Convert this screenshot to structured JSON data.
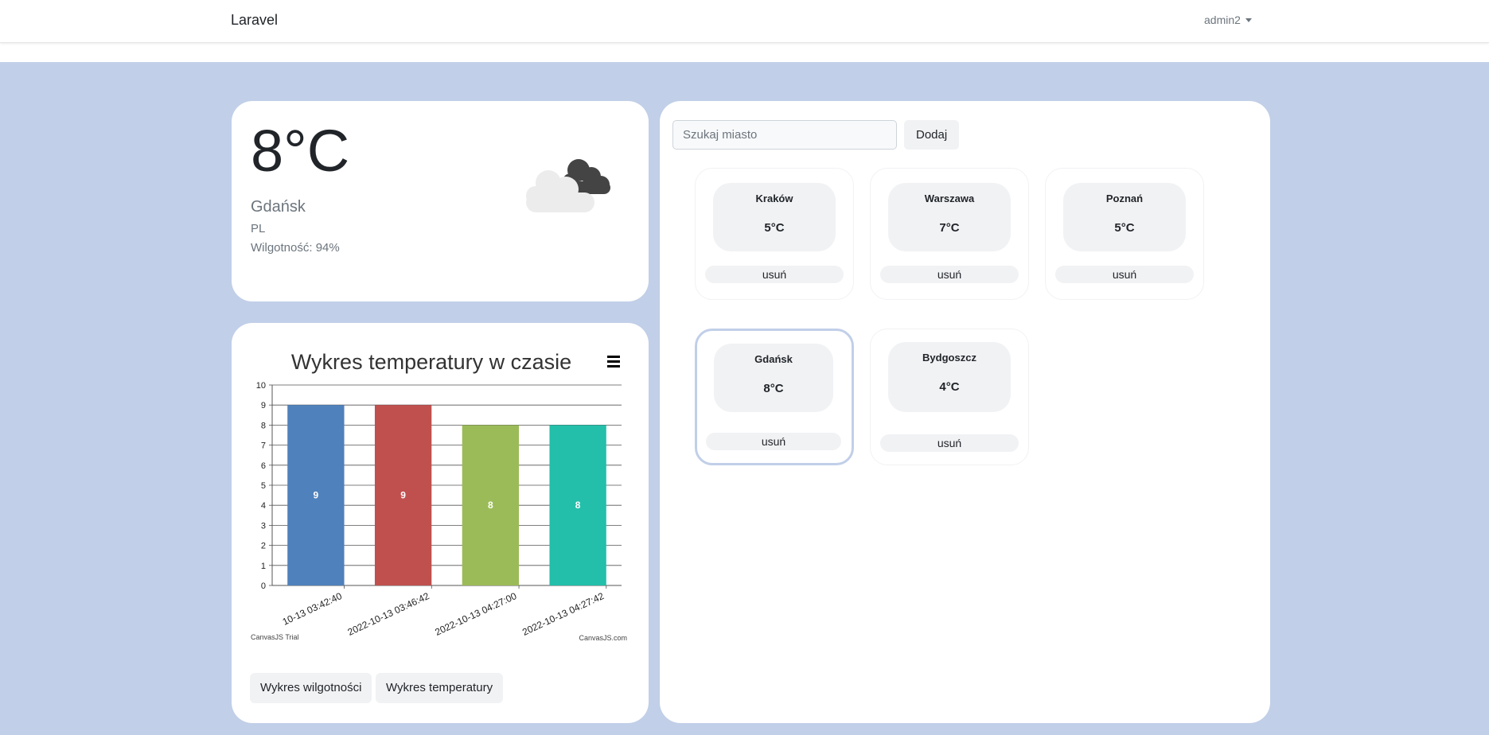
{
  "navbar": {
    "brand": "Laravel",
    "user": "admin2"
  },
  "current": {
    "temperature": "8°C",
    "city": "Gdańsk",
    "country": "PL",
    "humidity_label": "Wilgotność:",
    "humidity_value": "94%",
    "condition_icon": "cloud-icon"
  },
  "chart": {
    "menu_icon": "hamburger-menu-icon",
    "trial_label": "CanvasJS Trial",
    "credit_label": "CanvasJS.com",
    "buttons": {
      "humidity": "Wykres wilgotności",
      "temperature": "Wykres temperatury"
    }
  },
  "chart_data": {
    "type": "bar",
    "title": "Wykres temperatury w czasie",
    "categories": [
      "10-13 03:42:40",
      "2022-10-13 03:46:42",
      "2022-10-13 04:27:00",
      "2022-10-13 04:27:42"
    ],
    "values": [
      9,
      9,
      8,
      8
    ],
    "data_labels": [
      "9",
      "9",
      "8",
      "8"
    ],
    "colors": [
      "#4f81bc",
      "#c0504e",
      "#9bbb58",
      "#23bfaa"
    ],
    "ylim": [
      0,
      10
    ],
    "yticks": [
      "0",
      "1",
      "2",
      "3",
      "4",
      "5",
      "6",
      "7",
      "8",
      "9",
      "10"
    ],
    "xlabel": "",
    "ylabel": "",
    "grid": true
  },
  "search": {
    "placeholder": "Szukaj miasto",
    "add_label": "Dodaj"
  },
  "cities": [
    {
      "name": "Kraków",
      "temp": "5°C",
      "remove": "usuń",
      "selected": false
    },
    {
      "name": "Warszawa",
      "temp": "7°C",
      "remove": "usuń",
      "selected": false
    },
    {
      "name": "Poznań",
      "temp": "5°C",
      "remove": "usuń",
      "selected": false
    },
    {
      "name": "Gdańsk",
      "temp": "8°C",
      "remove": "usuń",
      "selected": true
    },
    {
      "name": "Bydgoszcz",
      "temp": "4°C",
      "remove": "usuń",
      "selected": false
    }
  ],
  "colors": {
    "background": "#c1cfe8",
    "card": "#ffffff",
    "chip": "#f1f2f4"
  }
}
